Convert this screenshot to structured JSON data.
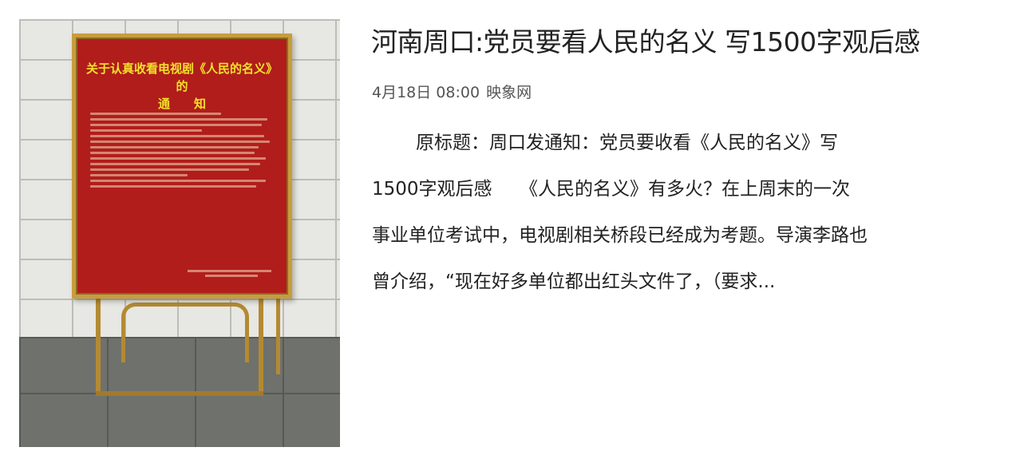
{
  "article": {
    "title": "河南周口:党员要看人民的名义 写1500字观后感",
    "date": "4月18日 08:00",
    "source": "映象网",
    "summary_lines": [
      "原标题：周口发通知：党员要收看《人民的名义》写",
      "1500字观后感　　《人民的名义》有多火？在上周末的一次",
      "事业单位考试中，电视剧相关桥段已经成为考题。导演李路也",
      "曾介绍，“现在好多单位都出红头文件了，（要求..."
    ]
  },
  "thumbnail": {
    "poster_title": "关于认真收看电视剧《人民的名义》的\n通　　知",
    "frame_color": "#c79d3c",
    "poster_color": "#b11d1a",
    "title_color": "#f2e02a"
  }
}
